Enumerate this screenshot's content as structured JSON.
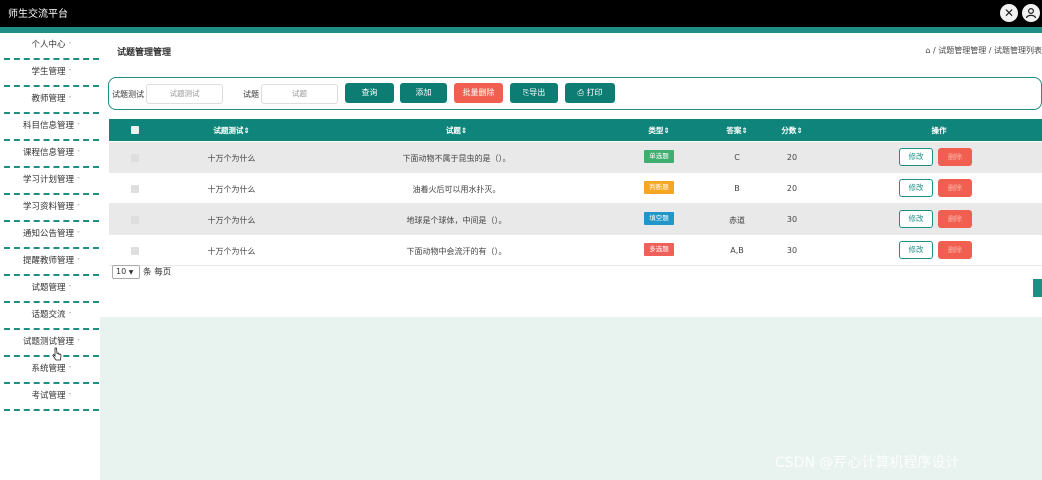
{
  "app": {
    "title": "师生交流平台"
  },
  "topbar": {
    "close_icon": "✕",
    "user_icon": "user-icon"
  },
  "sidebar": {
    "items": [
      {
        "label": "个人中心"
      },
      {
        "label": "学生管理"
      },
      {
        "label": "教师管理"
      },
      {
        "label": "科目信息管理"
      },
      {
        "label": "课程信息管理"
      },
      {
        "label": "学习计划管理"
      },
      {
        "label": "学习资料管理"
      },
      {
        "label": "通知公告管理"
      },
      {
        "label": "提醒教师管理"
      },
      {
        "label": "试题管理"
      },
      {
        "label": "话题交流"
      },
      {
        "label": "试题测试管理"
      },
      {
        "label": "系统管理"
      },
      {
        "label": "考试管理"
      }
    ],
    "caret": "˅"
  },
  "page": {
    "title": "试题管理管理",
    "breadcrumb": "⌂ / 试题管理管理 / 试题管理列表"
  },
  "search": {
    "label1": "试题测试",
    "placeholder1": "试题测试",
    "label2": "试题",
    "placeholder2": "试题",
    "btn_query": "查询",
    "btn_add": "添加",
    "btn_batch_delete": "批量删除",
    "btn_export": "导出",
    "btn_print": "打印"
  },
  "table": {
    "headers": {
      "test": "试题测试⇕",
      "question": "试题⇕",
      "type": "类型⇕",
      "answer": "答案⇕",
      "score": "分数⇕",
      "action": "操作"
    },
    "rows": [
      {
        "test": "十万个为什么",
        "question": "下面动物不属于昆虫的是（）。",
        "type": "单选题",
        "type_color": "#3fae6f",
        "answer": "C",
        "score": "20",
        "edit": "修改",
        "delete": "删除"
      },
      {
        "test": "十万个为什么",
        "question": "油着火后可以用水扑灭。",
        "type": "判断题",
        "type_color": "#f5a623",
        "answer": "B",
        "score": "20",
        "edit": "修改",
        "delete": "删除"
      },
      {
        "test": "十万个为什么",
        "question": "地球是个球体，中间是（）。",
        "type": "填空题",
        "type_color": "#2196c8",
        "answer": "赤道",
        "score": "30",
        "edit": "修改",
        "delete": "删除"
      },
      {
        "test": "十万个为什么",
        "question": "下面动物中会流汗的有（）。",
        "type": "多选题",
        "type_color": "#f0605a",
        "answer": "A,B",
        "score": "30",
        "edit": "修改",
        "delete": "删除"
      }
    ]
  },
  "pagination": {
    "per_page_value": "10",
    "per_page_suffix": "条 每页"
  },
  "watermark": "CSDN @芹心计算机程序设计",
  "colors": {
    "primary": "#1f8f85",
    "danger": "#f05f50",
    "header": "#000000"
  }
}
